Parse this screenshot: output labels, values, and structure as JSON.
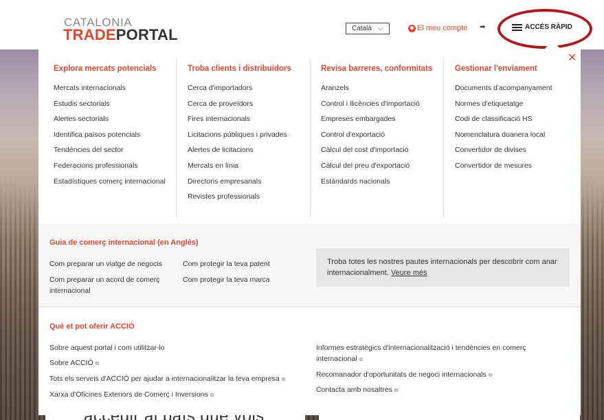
{
  "header": {
    "logo_line1": "CATALONIA",
    "logo_red": "TRADE",
    "logo_gray": "PORTAL",
    "language": "Català",
    "account_label": "El meu compte",
    "quick_access_label": "ACCÉS RÀPID"
  },
  "menu": {
    "columns": [
      {
        "title": "Explora mercats potencials",
        "items": [
          "Mercats internacionals",
          "Estudis sectorials",
          "Alertes sectorials",
          "Identifica països potencials",
          "Tendències del sector",
          "Federacions professionals",
          "Estadístiques comerç internacional"
        ]
      },
      {
        "title": "Troba clients i distribuïdors",
        "items": [
          "Cerca d'importadors",
          "Cerca de proveïdors",
          "Fires internacionals",
          "Licitacions públiques i privades",
          "Alertes de licitacions",
          "Mercats en línia",
          "Directoris empresarials",
          "Revistes professionals"
        ]
      },
      {
        "title": "Revisa barreres, conformitats",
        "items": [
          "Aranzels",
          "Control i llicències d'importació",
          "Empreses embargades",
          "Control d'exportació",
          "Càlcul del cost d'importació",
          "Càlcul del preu d'exportació",
          "Estàndards nacionals"
        ]
      },
      {
        "title": "Gestionar l'enviament",
        "items": [
          "Documents d'acompanyament",
          "Normes d'etiquetatge",
          "Codi de classificació HS",
          "Nomenclatura duanera local",
          "Convertidor de divises",
          "Convertidor de mesures"
        ]
      }
    ]
  },
  "guide": {
    "title": "Guia de comerç internacional (en Anglès)",
    "links": [
      "Com preparar un viatge de negocis",
      "Com preparar un acord de comerç internacional",
      "Com protegir la teva patent",
      "Com protegir la teva marca"
    ],
    "box_text": "Troba totes les nostres pautes internacionals per descobrir com anar internacionalment.",
    "box_link": "Veure més"
  },
  "offer": {
    "title": "Què et pot oferir ACCIÓ",
    "left_links": [
      "Sobre aquest portal i com utilitzar-lo",
      "Sobre ACCIÓ",
      "Tots els serveis d'ACCIÓ per ajudar a internacionalitzar la teva empresa",
      "Xarxa d'Oficines Exteriors de Comerç i Inversions"
    ],
    "right_links": [
      "Informes estratègics d'internacionalització i tendències en comerç internacional",
      "Recomanador d'oportunitats de negoci internacionals",
      "Contacta amb nosaltres"
    ]
  },
  "background": {
    "partial_text": "accedir al país que vols"
  },
  "colors": {
    "accent": "#e2452d",
    "highlight_ring": "#b0161a"
  }
}
